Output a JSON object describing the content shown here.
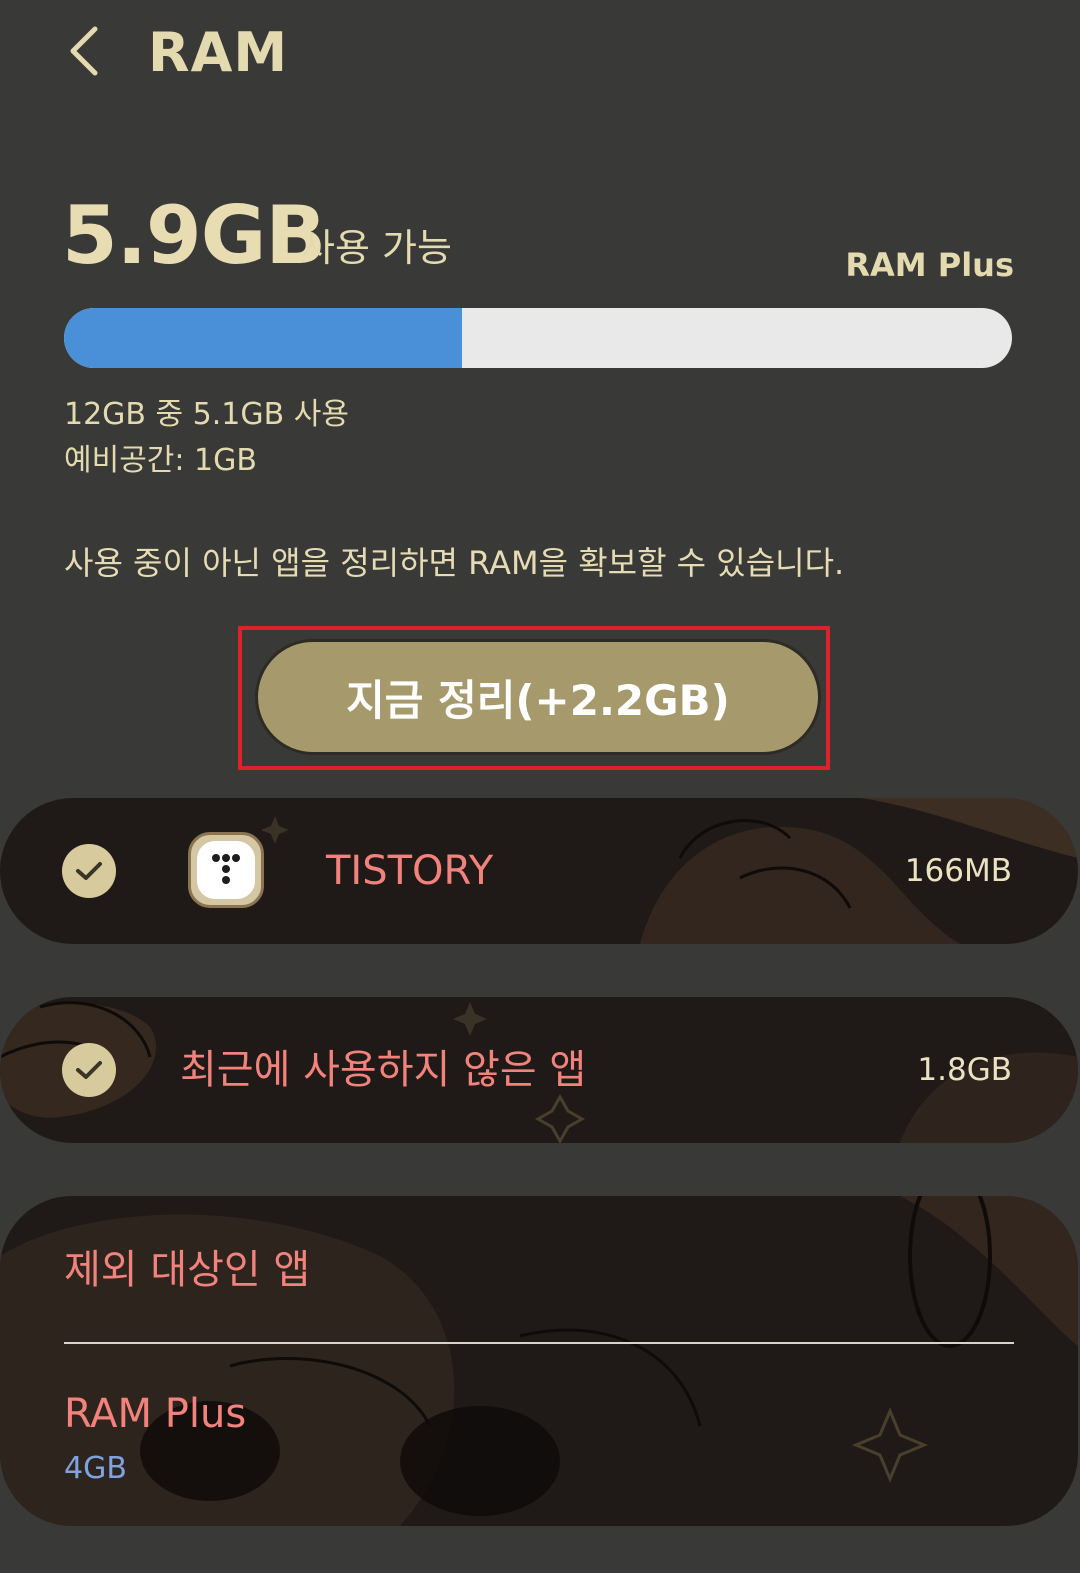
{
  "header": {
    "title": "RAM",
    "back_icon": "chevron-left-icon"
  },
  "summary": {
    "available_value": "5.9GB",
    "available_label": "사용 가능",
    "ram_plus_link": "RAM Plus",
    "usage_fraction": 0.42,
    "used_text": "12GB 중 5.1GB 사용",
    "reserve_text": "예비공간: 1GB",
    "info_text": "사용 중이 아닌 앱을 정리하면 RAM을 확보할 수 있습니다."
  },
  "clean_button": {
    "label": "지금 정리(+2.2GB)"
  },
  "apps": [
    {
      "name": "TISTORY",
      "size": "166MB",
      "checked": true
    },
    {
      "name": "최근에 사용하지 않은 앱",
      "size": "1.8GB",
      "checked": true
    }
  ],
  "settings": {
    "excluded_apps_label": "제외 대상인 앱",
    "ram_plus_label": "RAM Plus",
    "ram_plus_value": "4GB"
  },
  "colors": {
    "background": "#393937",
    "accent_text": "#e4dab0",
    "bar_fill": "#4a90d9",
    "button": "#a69a6c",
    "highlight": "#e0202a",
    "row_label": "#f2837c",
    "sub_value": "#7fa2e0"
  }
}
